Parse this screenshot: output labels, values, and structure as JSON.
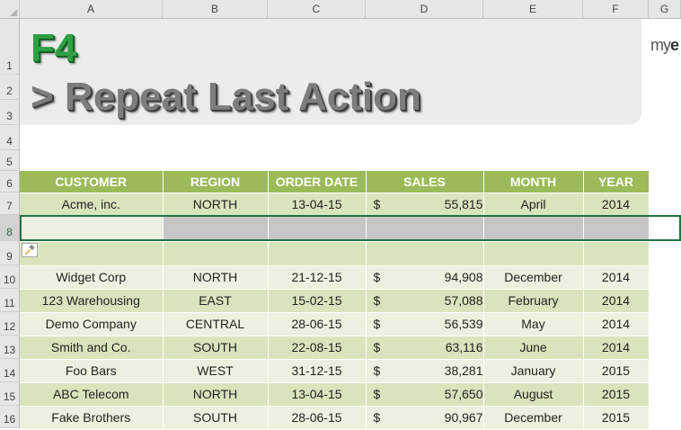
{
  "columns": [
    "A",
    "B",
    "C",
    "D",
    "E",
    "F",
    "G"
  ],
  "rows": [
    "1",
    "2",
    "3",
    "4",
    "5",
    "6",
    "7",
    "8",
    "9",
    "10",
    "11",
    "12",
    "13",
    "14",
    "15",
    "16"
  ],
  "banner": {
    "key": "F4",
    "title": "> Repeat Last Action",
    "brand_prefix": "my",
    "brand_suffix": "e"
  },
  "table": {
    "headers": [
      "CUSTOMER",
      "REGION",
      "ORDER DATE",
      "SALES",
      "MONTH",
      "YEAR"
    ],
    "currency_symbol": "$",
    "data": [
      {
        "customer": "Acme, inc.",
        "region": "NORTH",
        "order_date": "13-04-15",
        "sales": "55,815",
        "month": "April",
        "year": "2014"
      },
      {
        "customer": "Widget Corp",
        "region": "NORTH",
        "order_date": "21-12-15",
        "sales": "94,908",
        "month": "December",
        "year": "2014"
      },
      {
        "customer": "123 Warehousing",
        "region": "EAST",
        "order_date": "15-02-15",
        "sales": "57,088",
        "month": "February",
        "year": "2014"
      },
      {
        "customer": "Demo Company",
        "region": "CENTRAL",
        "order_date": "28-06-15",
        "sales": "56,539",
        "month": "May",
        "year": "2014"
      },
      {
        "customer": "Smith and Co.",
        "region": "SOUTH",
        "order_date": "22-08-15",
        "sales": "63,116",
        "month": "June",
        "year": "2014"
      },
      {
        "customer": "Foo Bars",
        "region": "WEST",
        "order_date": "31-12-15",
        "sales": "38,281",
        "month": "January",
        "year": "2015"
      },
      {
        "customer": "ABC Telecom",
        "region": "NORTH",
        "order_date": "13-04-15",
        "sales": "57,650",
        "month": "August",
        "year": "2015"
      },
      {
        "customer": "Fake Brothers",
        "region": "SOUTH",
        "order_date": "28-06-15",
        "sales": "90,967",
        "month": "December",
        "year": "2015"
      }
    ]
  },
  "selected_row": "8",
  "colors": {
    "header_green": "#9bbb59",
    "band_light": "#ebf1de",
    "band_dark": "#d8e4bc",
    "f4_green": "#2ea043",
    "selection": "#217346"
  }
}
